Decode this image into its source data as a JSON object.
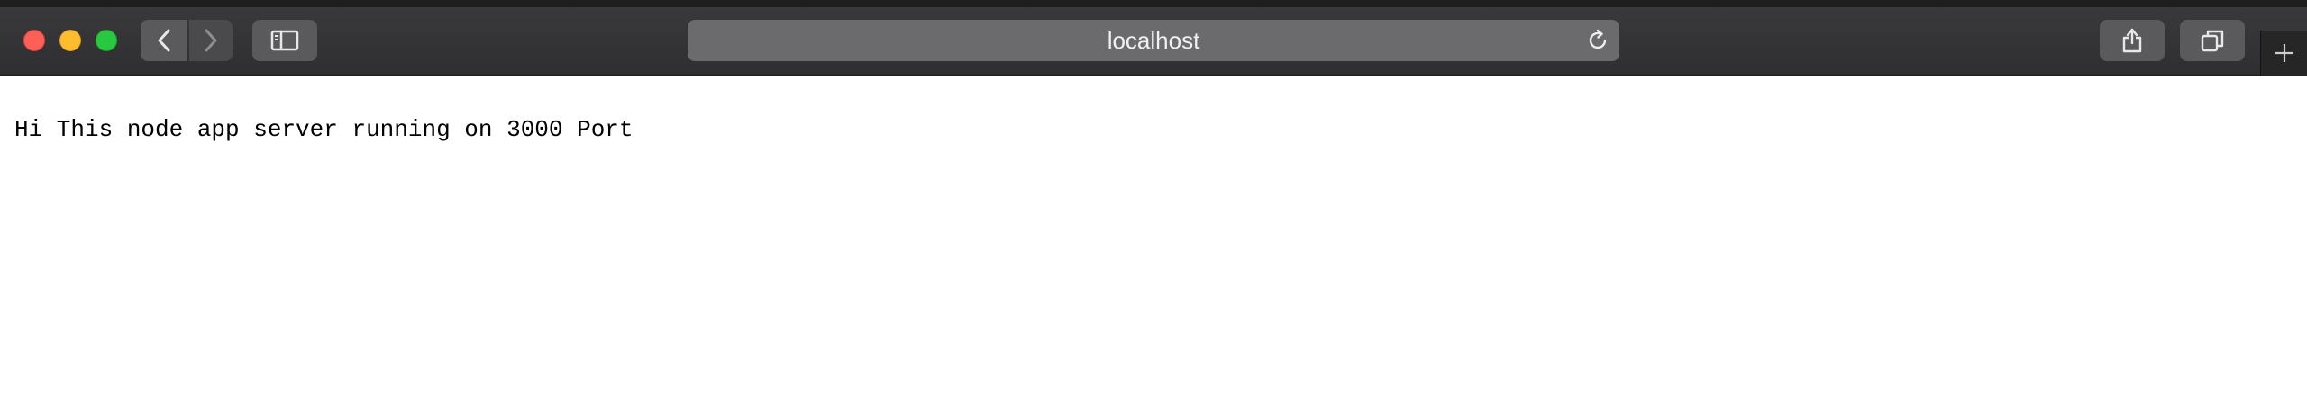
{
  "browser": {
    "address": "localhost",
    "icons": {
      "back": "chevron-left-icon",
      "forward": "chevron-right-icon",
      "sidebar": "sidebar-icon",
      "reload": "reload-icon",
      "share": "share-icon",
      "tabs": "tab-overview-icon",
      "new_tab": "plus-icon"
    },
    "colors": {
      "toolbar": "#2f2f31",
      "close": "#fe5f57",
      "minimize": "#febc2e",
      "maximize": "#28c840"
    }
  },
  "page": {
    "body_text": "Hi This node app server running on 3000 Port"
  }
}
